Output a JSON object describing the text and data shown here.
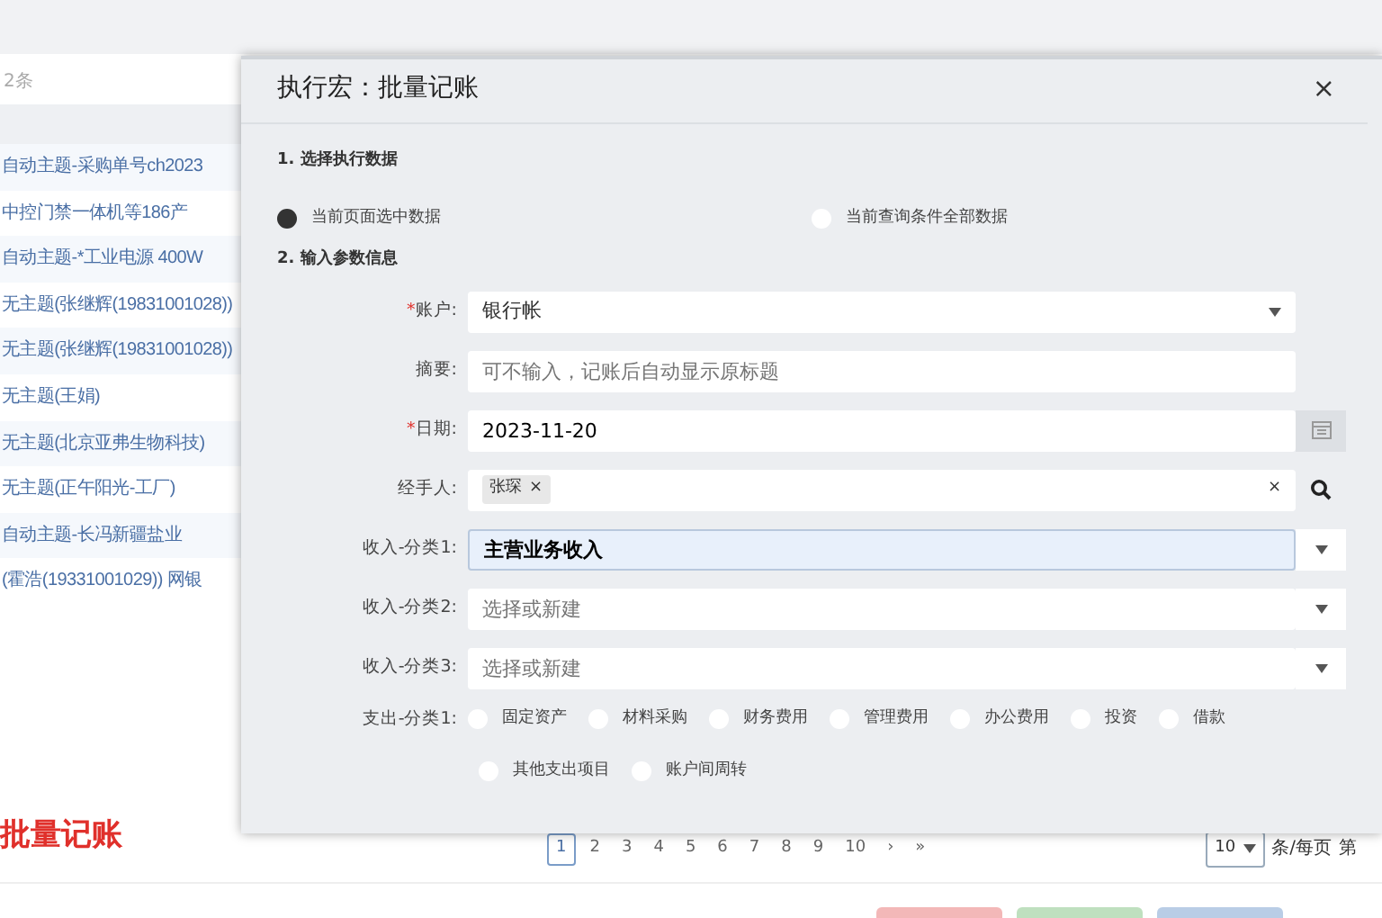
{
  "background": {
    "search_hint": "2条",
    "rows": [
      "自动主题-采购单号ch2023",
      "中控门禁一体机等186产",
      "自动主题-*工业电源 400W",
      "无主题(张继辉(19831001028))",
      "无主题(张继辉(19831001028))",
      "无主题(王娟)",
      "无主题(北京亚弗生物科技)",
      "无主题(正午阳光-工厂)",
      "自动主题-长冯新疆盐业",
      "(霍浩(19331001029)) 网银"
    ],
    "page_title": "批量记账",
    "pagination": {
      "pages": [
        {
          "label": "1",
          "selected": true
        },
        {
          "label": "2",
          "selected": false
        },
        {
          "label": "3",
          "selected": false
        },
        {
          "label": "4",
          "selected": false
        },
        {
          "label": "5",
          "selected": false
        },
        {
          "label": "6",
          "selected": false
        },
        {
          "label": "7",
          "selected": false
        },
        {
          "label": "8",
          "selected": false
        },
        {
          "label": "9",
          "selected": false
        },
        {
          "label": "10",
          "selected": false
        }
      ],
      "next": "›",
      "last": "»",
      "page_size": "10",
      "per_page_label": "条/每页",
      "page_label": "第"
    },
    "bottom_buttons": [
      {
        "color": "#f3b8b8"
      },
      {
        "color": "#bfe0bf"
      },
      {
        "color": "#b9cde6"
      }
    ]
  },
  "dialog": {
    "title": "执行宏：批量记账",
    "close": "×",
    "section_1": "1. 选择执行数据",
    "scope_options": [
      {
        "label": "当前页面选中数据",
        "selected": true
      },
      {
        "label": "当前查询条件全部数据",
        "selected": false
      }
    ],
    "section_2": "2. 输入参数信息",
    "fields": [
      {
        "kind": "select",
        "required_mark": "*",
        "label": "账户:",
        "value": "银行帐"
      },
      {
        "kind": "text",
        "label": "摘要:",
        "placeholder": "可不输入，记账后自动显示原标题"
      },
      {
        "kind": "date",
        "required_mark": "*",
        "label": "日期:",
        "value": "2023-11-20"
      },
      {
        "kind": "tags",
        "label": "经手人:",
        "tags": [
          {
            "label": "张琛",
            "remove": "×"
          }
        ],
        "clear": "×"
      },
      {
        "kind": "combo",
        "label": "收入-分类1:",
        "value": "主营业务收入",
        "focused": true
      },
      {
        "kind": "combo",
        "label": "收入-分类2:",
        "placeholder": "选择或新建",
        "focused": false
      },
      {
        "kind": "combo",
        "label": "收入-分类3:",
        "placeholder": "选择或新建",
        "focused": false
      }
    ],
    "expense": {
      "label": "支出-分类1:",
      "options": [
        {
          "label": "固定资产",
          "selected": false
        },
        {
          "label": "材料采购",
          "selected": false
        },
        {
          "label": "财务费用",
          "selected": false
        },
        {
          "label": "管理费用",
          "selected": false
        },
        {
          "label": "办公费用",
          "selected": false
        },
        {
          "label": "投资",
          "selected": false
        },
        {
          "label": "借款",
          "selected": false
        },
        {
          "label": "其他支出项目",
          "selected": false
        },
        {
          "label": "账户间周转",
          "selected": false
        }
      ]
    }
  }
}
